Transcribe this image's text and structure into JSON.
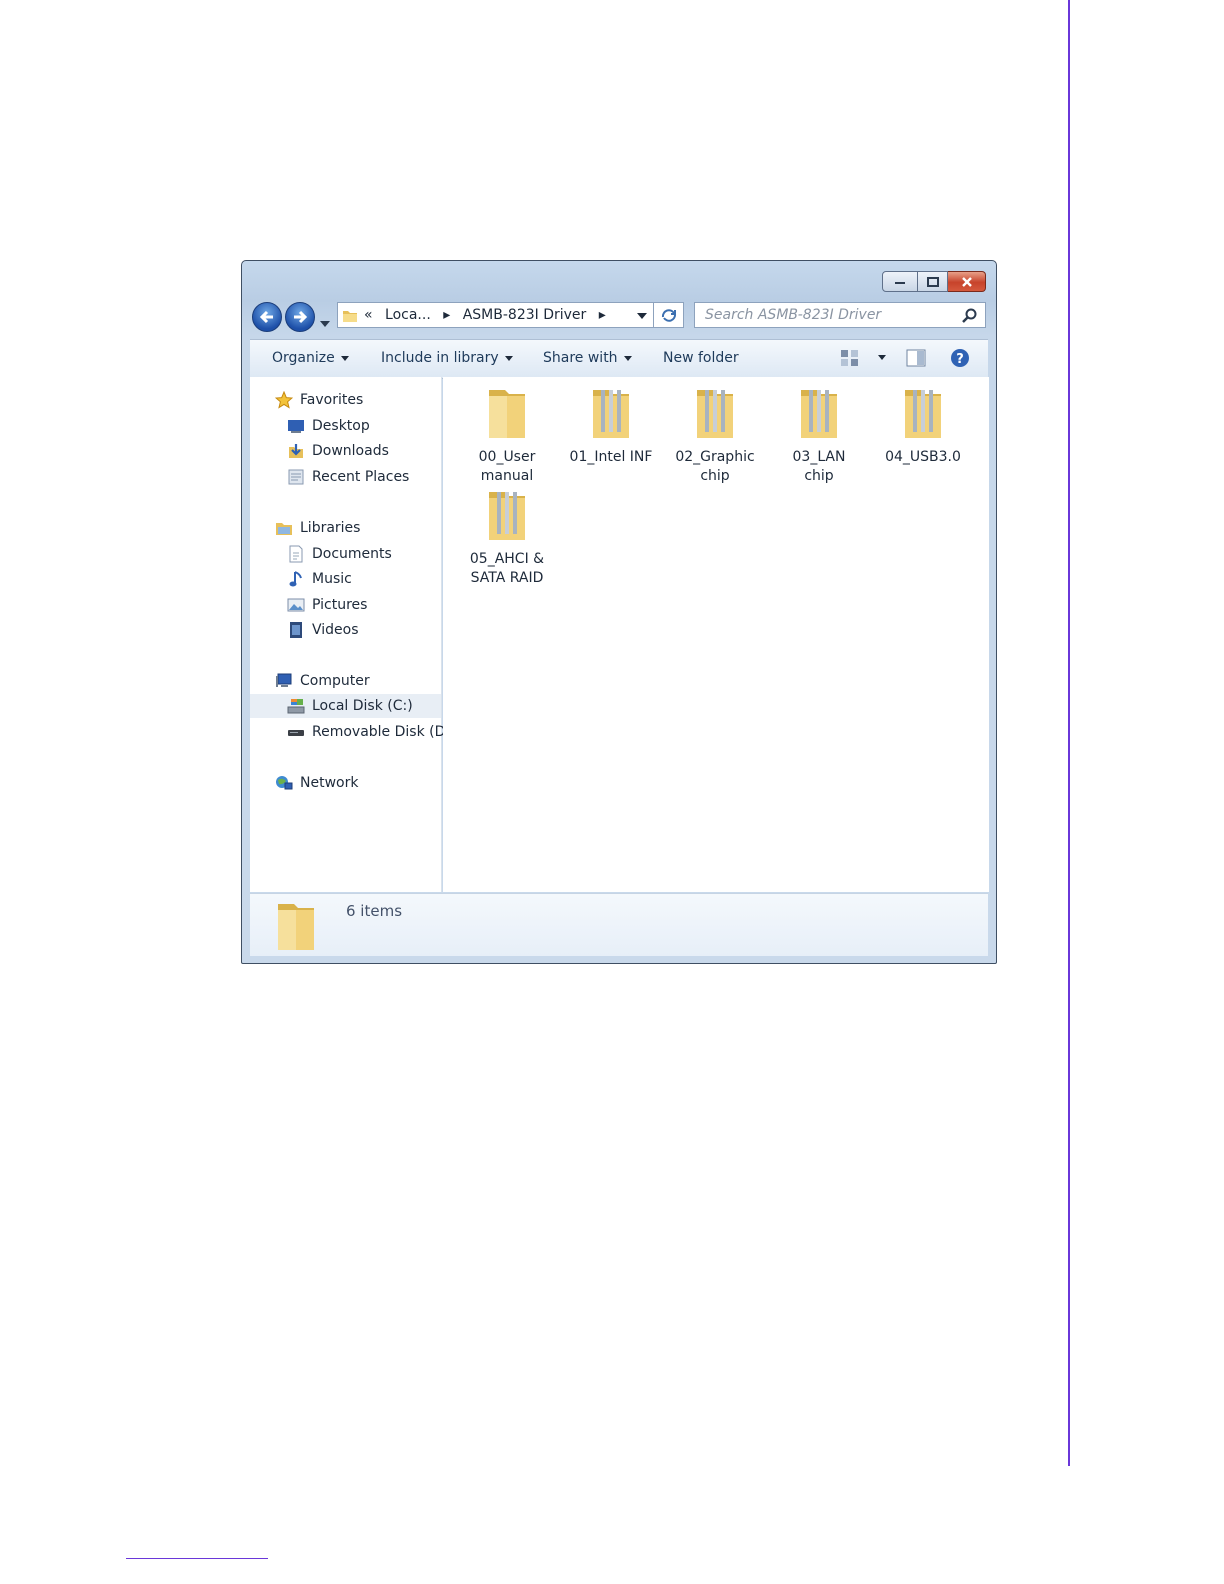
{
  "window": {
    "address": {
      "chevrons": "«",
      "crumbs": [
        "Loca...",
        "ASMB-823I Driver"
      ]
    },
    "search_placeholder": "Search ASMB-823I Driver",
    "toolbar": {
      "organize": "Organize",
      "include": "Include in library",
      "share": "Share with",
      "new_folder": "New folder"
    },
    "nav": {
      "favorites": "Favorites",
      "desktop": "Desktop",
      "downloads": "Downloads",
      "recent": "Recent Places",
      "libraries": "Libraries",
      "documents": "Documents",
      "music": "Music",
      "pictures": "Pictures",
      "videos": "Videos",
      "computer": "Computer",
      "local_disk": "Local Disk (C:)",
      "removable": "Removable Disk (D:)",
      "network": "Network"
    },
    "items": [
      {
        "line1": "00_User",
        "line2": "manual"
      },
      {
        "line1": "01_Intel INF",
        "line2": ""
      },
      {
        "line1": "02_Graphic",
        "line2": "chip"
      },
      {
        "line1": "03_LAN",
        "line2": "chip"
      },
      {
        "line1": "04_USB3.0",
        "line2": ""
      },
      {
        "line1": "05_AHCI &",
        "line2": "SATA RAID"
      }
    ],
    "status": "6 items",
    "colors": {
      "accent_rule": "#6a37d9",
      "folder": "#f2d27a",
      "close_button": "#c7432b"
    }
  }
}
